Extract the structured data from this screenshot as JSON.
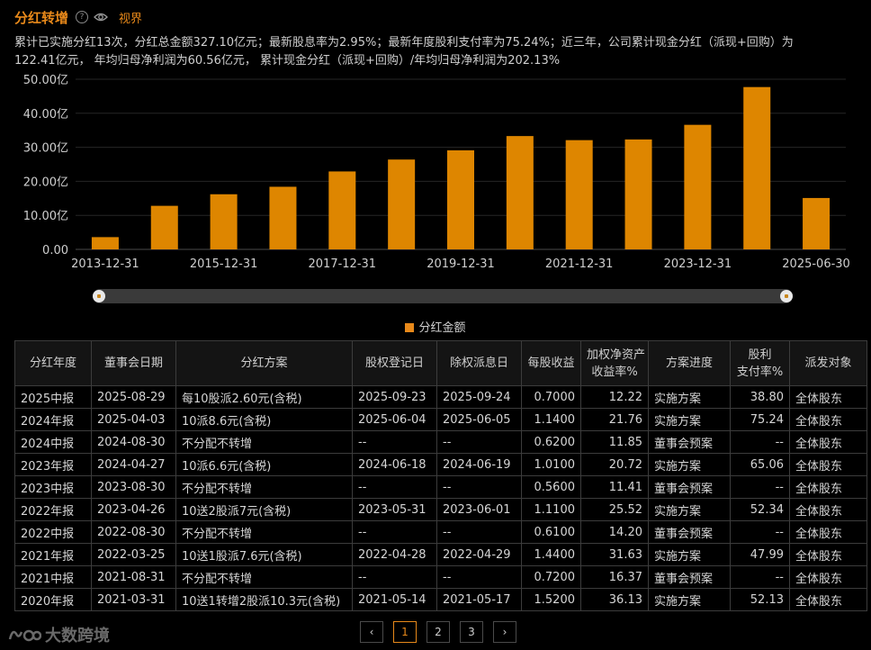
{
  "header": {
    "title": "分红转增",
    "help_icon": "?",
    "view_link": "视界"
  },
  "summary": {
    "line1": "累计已实施分红13次，分红总金额327.10亿元；最新股息率为2.95%；最新年度股利支付率为75.24%；近三年，公司累计现金分红（派现+回购）为",
    "line2": "122.41亿元， 年均归母净利润为60.56亿元， 累计现金分红（派现+回购）/年均归母净利润为202.13%"
  },
  "colors": {
    "accent": "#e8891a",
    "bar": "#de8600"
  },
  "chart_data": {
    "type": "bar",
    "categories": [
      "2013-12-31",
      "2014-12-31",
      "2015-12-31",
      "2016-12-31",
      "2017-12-31",
      "2018-12-31",
      "2019-12-31",
      "2020-12-31",
      "2021-12-31",
      "2022-12-31",
      "2023-12-31",
      "2024-12-31",
      "2025-06-30"
    ],
    "x_tick_labels": [
      "2013-12-31",
      "2015-12-31",
      "2017-12-31",
      "2019-12-31",
      "2021-12-31",
      "2023-12-31",
      "2025-06-30"
    ],
    "series": [
      {
        "name": "分红金额",
        "values": [
          3.6,
          12.8,
          16.2,
          18.4,
          22.9,
          26.4,
          29.1,
          33.3,
          32.1,
          32.3,
          36.6,
          47.7,
          15.1
        ]
      }
    ],
    "y_ticks": [
      "0.00",
      "10.00亿",
      "20.00亿",
      "30.00亿",
      "40.00亿",
      "50.00亿"
    ],
    "ylim": [
      0,
      50
    ],
    "grid": true,
    "legend_position": "bottom-center"
  },
  "legend": {
    "label": "分红金额"
  },
  "table": {
    "headers": [
      {
        "l1": "分红年度",
        "l2": ""
      },
      {
        "l1": "董事会日期",
        "l2": ""
      },
      {
        "l1": "分红方案",
        "l2": ""
      },
      {
        "l1": "股权登记日",
        "l2": ""
      },
      {
        "l1": "除权派息日",
        "l2": ""
      },
      {
        "l1": "每股收益",
        "l2": ""
      },
      {
        "l1": "加权净资产",
        "l2": "收益率%"
      },
      {
        "l1": "方案进度",
        "l2": ""
      },
      {
        "l1": "股利",
        "l2": "支付率%"
      },
      {
        "l1": "派发对象",
        "l2": ""
      }
    ],
    "rows": [
      [
        "2025中报",
        "2025-08-29",
        "每10股派2.60元(含税)",
        "2025-09-23",
        "2025-09-24",
        "0.7000",
        "12.22",
        "实施方案",
        "38.80",
        "全体股东"
      ],
      [
        "2024年报",
        "2025-04-03",
        "10派8.6元(含税)",
        "2025-06-04",
        "2025-06-05",
        "1.1400",
        "21.76",
        "实施方案",
        "75.24",
        "全体股东"
      ],
      [
        "2024中报",
        "2024-08-30",
        "不分配不转增",
        "--",
        "--",
        "0.6200",
        "11.85",
        "董事会预案",
        "--",
        "全体股东"
      ],
      [
        "2023年报",
        "2024-04-27",
        "10派6.6元(含税)",
        "2024-06-18",
        "2024-06-19",
        "1.0100",
        "20.72",
        "实施方案",
        "65.06",
        "全体股东"
      ],
      [
        "2023中报",
        "2023-08-30",
        "不分配不转增",
        "--",
        "--",
        "0.5600",
        "11.41",
        "董事会预案",
        "--",
        "全体股东"
      ],
      [
        "2022年报",
        "2023-04-26",
        "10送2股派7元(含税)",
        "2023-05-31",
        "2023-06-01",
        "1.1100",
        "25.52",
        "实施方案",
        "52.34",
        "全体股东"
      ],
      [
        "2022中报",
        "2022-08-30",
        "不分配不转增",
        "--",
        "--",
        "0.6100",
        "14.20",
        "董事会预案",
        "--",
        "全体股东"
      ],
      [
        "2021年报",
        "2022-03-25",
        "10送1股派7.6元(含税)",
        "2022-04-28",
        "2022-04-29",
        "1.4400",
        "31.63",
        "实施方案",
        "47.99",
        "全体股东"
      ],
      [
        "2021中报",
        "2021-08-31",
        "不分配不转增",
        "--",
        "--",
        "0.7200",
        "16.37",
        "董事会预案",
        "--",
        "全体股东"
      ],
      [
        "2020年报",
        "2021-03-31",
        "10送1转增2股派10.3元(含税)",
        "2021-05-14",
        "2021-05-17",
        "1.5200",
        "36.13",
        "实施方案",
        "52.13",
        "全体股东"
      ]
    ]
  },
  "pagination": {
    "prev": "‹",
    "pages": [
      "1",
      "2",
      "3"
    ],
    "active_page": "1",
    "next": "›"
  },
  "watermark": {
    "text": "大数跨境"
  }
}
